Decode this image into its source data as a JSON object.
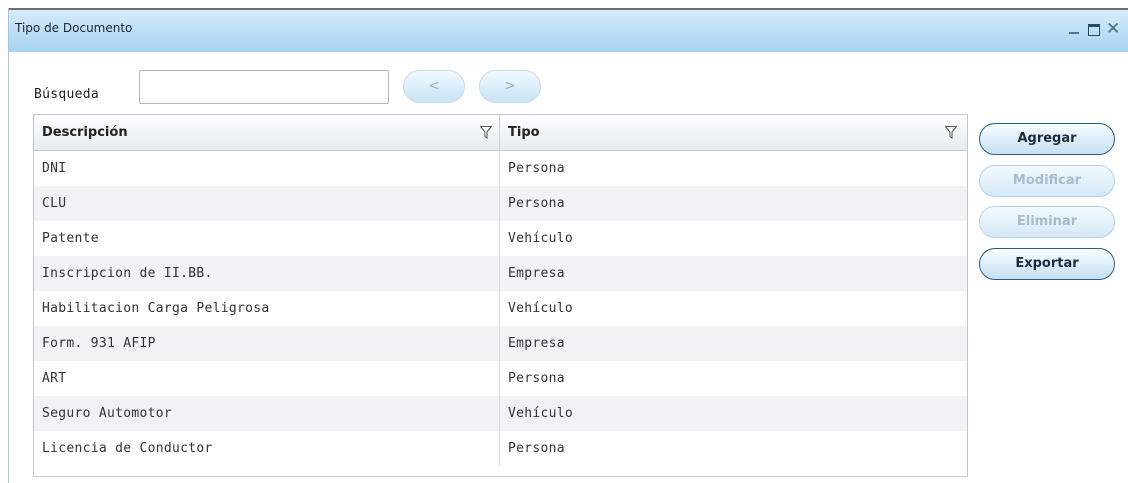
{
  "window": {
    "title": "Tipo de Documento",
    "close_glyph": "✕"
  },
  "search": {
    "label": "Búsqueda",
    "value": "",
    "placeholder": "",
    "prev_label": "<",
    "next_label": ">"
  },
  "grid": {
    "columns": [
      "Descripción",
      "Tipo"
    ],
    "rows": [
      {
        "descripcion": "DNI",
        "tipo": "Persona"
      },
      {
        "descripcion": "CLU",
        "tipo": "Persona"
      },
      {
        "descripcion": "Patente",
        "tipo": "Vehículo"
      },
      {
        "descripcion": "Inscripcion de II.BB.",
        "tipo": "Empresa"
      },
      {
        "descripcion": "Habilitacion Carga Peligrosa",
        "tipo": "Vehículo"
      },
      {
        "descripcion": "Form. 931 AFIP",
        "tipo": "Empresa"
      },
      {
        "descripcion": "ART",
        "tipo": "Persona"
      },
      {
        "descripcion": "Seguro Automotor",
        "tipo": "Vehículo"
      },
      {
        "descripcion": "Licencia de Conductor",
        "tipo": "Persona"
      }
    ]
  },
  "actions": {
    "agregar": "Agregar",
    "modificar": "Modificar",
    "eliminar": "Eliminar",
    "exportar": "Exportar"
  },
  "colors": {
    "titlebar": "#bfe0f6",
    "button_border": "#2e5b80",
    "alt_row": "#f1f2f4"
  }
}
